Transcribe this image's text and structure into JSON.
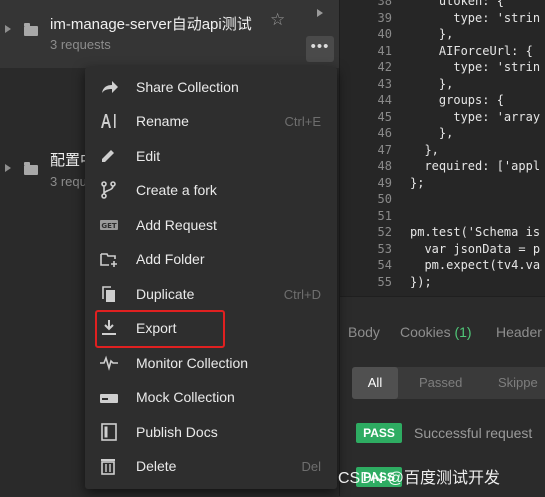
{
  "sidebar": {
    "collections": [
      {
        "name": "im-manage-server自动api测试",
        "subtitle": "3 requests"
      },
      {
        "name": "配置中",
        "subtitle": "3 requ"
      }
    ],
    "more_label": "•••"
  },
  "editor": {
    "lines": [
      {
        "n": "38",
        "text": "    utoken: {"
      },
      {
        "n": "39",
        "text": "      type: 'strin"
      },
      {
        "n": "40",
        "text": "    },"
      },
      {
        "n": "41",
        "text": "    AIForceUrl: {"
      },
      {
        "n": "42",
        "text": "      type: 'strin"
      },
      {
        "n": "43",
        "text": "    },"
      },
      {
        "n": "44",
        "text": "    groups: {"
      },
      {
        "n": "45",
        "text": "      type: 'array"
      },
      {
        "n": "46",
        "text": "    },"
      },
      {
        "n": "47",
        "text": "  },"
      },
      {
        "n": "48",
        "text": "  required: ['appl"
      },
      {
        "n": "49",
        "text": "};"
      },
      {
        "n": "50",
        "text": ""
      },
      {
        "n": "51",
        "text": ""
      },
      {
        "n": "52",
        "text": "pm.test('Schema is"
      },
      {
        "n": "53",
        "text": "  var jsonData = p"
      },
      {
        "n": "54",
        "text": "  pm.expect(tv4.va"
      },
      {
        "n": "55",
        "text": "});"
      }
    ]
  },
  "response": {
    "tabs": {
      "body": "Body",
      "cookies": "Cookies",
      "cookies_count": "(1)",
      "headers": "Header"
    },
    "filters": {
      "all": "All",
      "passed": "Passed",
      "skipped": "Skippe"
    },
    "results": [
      {
        "status": "PASS",
        "text": "Successful request"
      },
      {
        "status": "PASS",
        "text": ""
      }
    ]
  },
  "menu": {
    "items": [
      {
        "label": "Share Collection",
        "shortcut": "",
        "icon": "share-icon"
      },
      {
        "label": "Rename",
        "shortcut": "Ctrl+E",
        "icon": "rename-icon"
      },
      {
        "label": "Edit",
        "shortcut": "",
        "icon": "pencil-icon"
      },
      {
        "label": "Create a fork",
        "shortcut": "",
        "icon": "fork-icon"
      },
      {
        "label": "Add Request",
        "shortcut": "",
        "icon": "get-request-icon"
      },
      {
        "label": "Add Folder",
        "shortcut": "",
        "icon": "add-folder-icon"
      },
      {
        "label": "Duplicate",
        "shortcut": "Ctrl+D",
        "icon": "duplicate-icon"
      },
      {
        "label": "Export",
        "shortcut": "",
        "icon": "download-icon"
      },
      {
        "label": "Monitor Collection",
        "shortcut": "",
        "icon": "pulse-icon"
      },
      {
        "label": "Mock Collection",
        "shortcut": "",
        "icon": "server-icon"
      },
      {
        "label": "Publish Docs",
        "shortcut": "",
        "icon": "docs-icon"
      },
      {
        "label": "Delete",
        "shortcut": "Del",
        "icon": "trash-icon"
      }
    ],
    "highlight_color": "#e02020"
  },
  "watermark": "CSDN @百度测试开发",
  "colors": {
    "pass": "#2eac62",
    "accent_count": "#50c878",
    "background": "#2b2b2b"
  }
}
